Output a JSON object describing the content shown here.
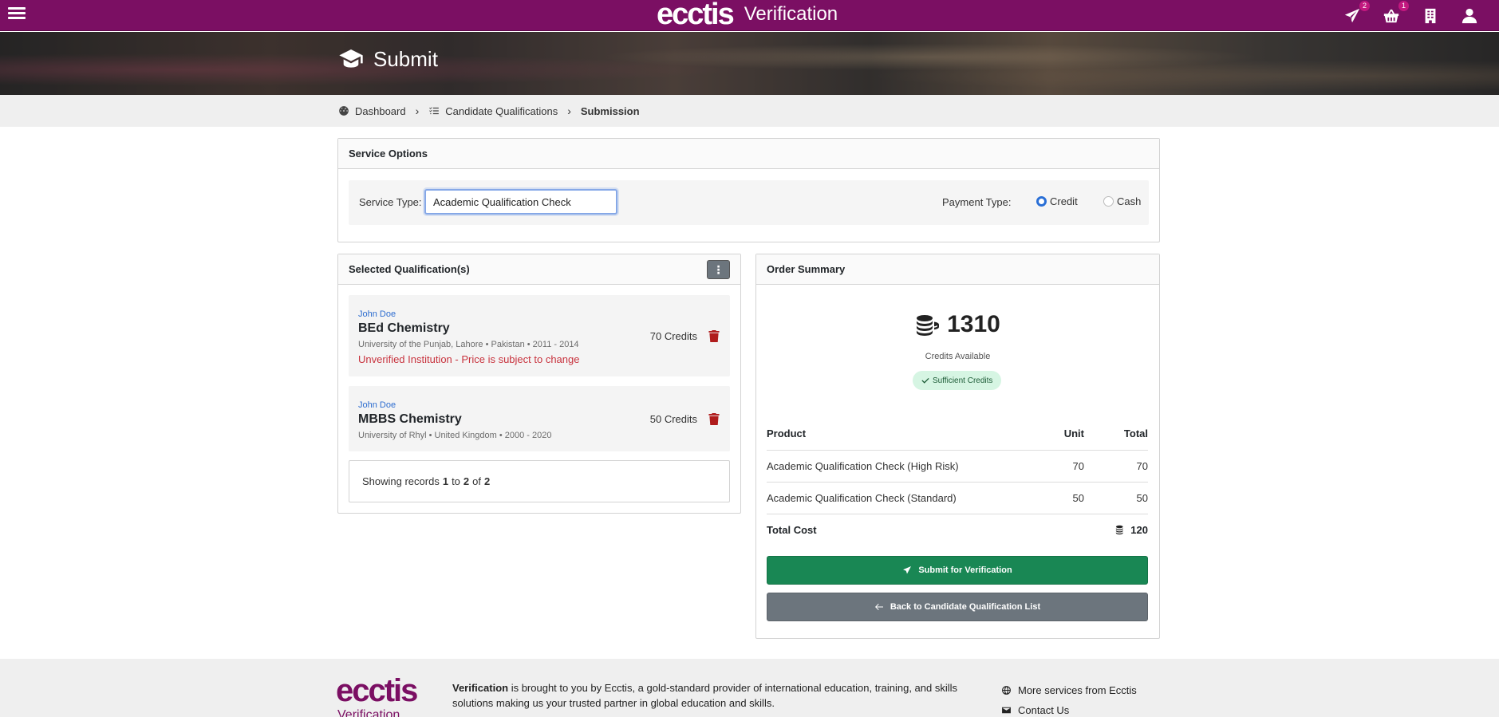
{
  "app": {
    "brand_logo": "ecctis",
    "brand_title": "Verification",
    "badges": {
      "send": "2",
      "basket": "1"
    }
  },
  "hero": {
    "title": "Submit"
  },
  "breadcrumb": {
    "items": [
      "Dashboard",
      "Candidate Qualifications"
    ],
    "current": "Submission"
  },
  "service_options": {
    "heading": "Service Options",
    "service_type_label": "Service Type:",
    "service_type_value": "Academic Qualification Check",
    "payment_type_label": "Payment Type:",
    "payment_options": [
      "Credit",
      "Cash"
    ],
    "payment_selected": "Credit"
  },
  "qualifications": {
    "heading": "Selected Qualification(s)",
    "items": [
      {
        "candidate": "John Doe",
        "title": "BEd Chemistry",
        "meta": "University of the Punjab, Lahore • Pakistan • 2011 - 2014",
        "warning": "Unverified Institution - Price is subject to change",
        "credits": "70 Credits"
      },
      {
        "candidate": "John Doe",
        "title": "MBBS Chemistry",
        "meta": "University of Rhyl • United Kingdom • 2000 - 2020",
        "warning": "",
        "credits": "50 Credits"
      }
    ],
    "records": {
      "prefix": "Showing records",
      "from": "1",
      "to_word": "to",
      "to": "2",
      "of_word": "of",
      "total": "2"
    }
  },
  "order_summary": {
    "heading": "Order Summary",
    "credits_available": "1310",
    "credits_available_label": "Credits Available",
    "sufficiency_badge": "Sufficient Credits",
    "columns": {
      "product": "Product",
      "unit": "Unit",
      "total": "Total"
    },
    "rows": [
      {
        "product": "Academic Qualification Check (High Risk)",
        "unit": "70",
        "total": "70"
      },
      {
        "product": "Academic Qualification Check (Standard)",
        "unit": "50",
        "total": "50"
      }
    ],
    "total_cost_label": "Total Cost",
    "total_cost": "120",
    "submit_label": "Submit for Verification",
    "back_label": "Back to Candidate Qualification List"
  },
  "footer": {
    "logo": "ecctis",
    "logo_sub": "Verification",
    "brand_word": "Verification",
    "text": "is brought to you by Ecctis, a gold-standard provider of international education, training, and skills solutions making us your trusted partner in global education and skills.",
    "links": [
      "More services from Ecctis",
      "Contact Us"
    ]
  },
  "colors": {
    "brand": "#7b0f63",
    "submit": "#198754",
    "secondary": "#6c757d",
    "warning_text": "#c8333e",
    "link": "#2c6ccf"
  },
  "icons": {
    "hero": "graduation-cap-icon",
    "top": [
      "send-icon",
      "basket-icon",
      "building-icon",
      "user-icon"
    ],
    "credits": "coins-icon"
  }
}
